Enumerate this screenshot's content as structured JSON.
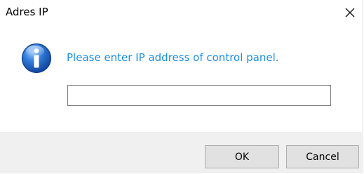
{
  "window": {
    "title": "Adres IP",
    "close_icon": "close-icon"
  },
  "dialog": {
    "icon": "info-icon",
    "message": "Please enter IP address of control panel.",
    "message_color": "#1b8fe6",
    "input_value": "",
    "input_placeholder": ""
  },
  "buttons": {
    "ok_label": "OK",
    "cancel_label": "Cancel"
  }
}
